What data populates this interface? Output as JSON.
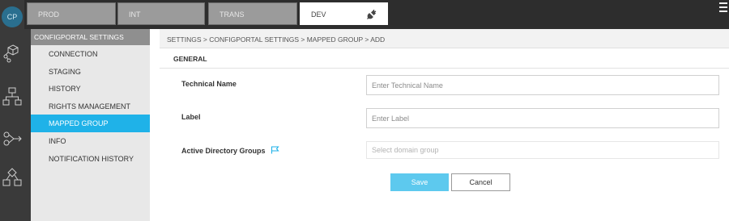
{
  "app": {
    "logo_text": "CP"
  },
  "rail": {
    "icons": [
      "cube-network-icon",
      "hierarchy-icon",
      "workflow-icon",
      "diagram-icon"
    ]
  },
  "env_tabs": [
    {
      "label": "PROD",
      "active": false
    },
    {
      "label": "INT",
      "active": false
    },
    {
      "label": "TRANS",
      "active": false
    },
    {
      "label": "DEV",
      "active": true
    }
  ],
  "sidebar": {
    "title": "CONFIGPORTAL SETTINGS",
    "items": [
      {
        "label": "CONNECTION",
        "active": false
      },
      {
        "label": "STAGING",
        "active": false
      },
      {
        "label": "HISTORY",
        "active": false
      },
      {
        "label": "RIGHTS MANAGEMENT",
        "active": false
      },
      {
        "label": "MAPPED GROUP",
        "active": true
      },
      {
        "label": "INFO",
        "active": false
      },
      {
        "label": "NOTIFICATION HISTORY",
        "active": false
      }
    ]
  },
  "breadcrumb": "SETTINGS > CONFIGPORTAL SETTINGS > MAPPED GROUP > ADD",
  "form": {
    "section_title": "GENERAL",
    "fields": [
      {
        "label": "Technical Name",
        "placeholder": "Enter Technical Name",
        "value": ""
      },
      {
        "label": "Label",
        "placeholder": "Enter Label",
        "value": ""
      },
      {
        "label": "Active Directory Groups",
        "placeholder": "Select domain group",
        "value": ""
      }
    ],
    "save_label": "Save",
    "cancel_label": "Cancel"
  },
  "colors": {
    "accent": "#1fb2e8",
    "save_button": "#5dc9ee",
    "topbar": "#2d2d2d",
    "rail": "#3a3a3a"
  }
}
